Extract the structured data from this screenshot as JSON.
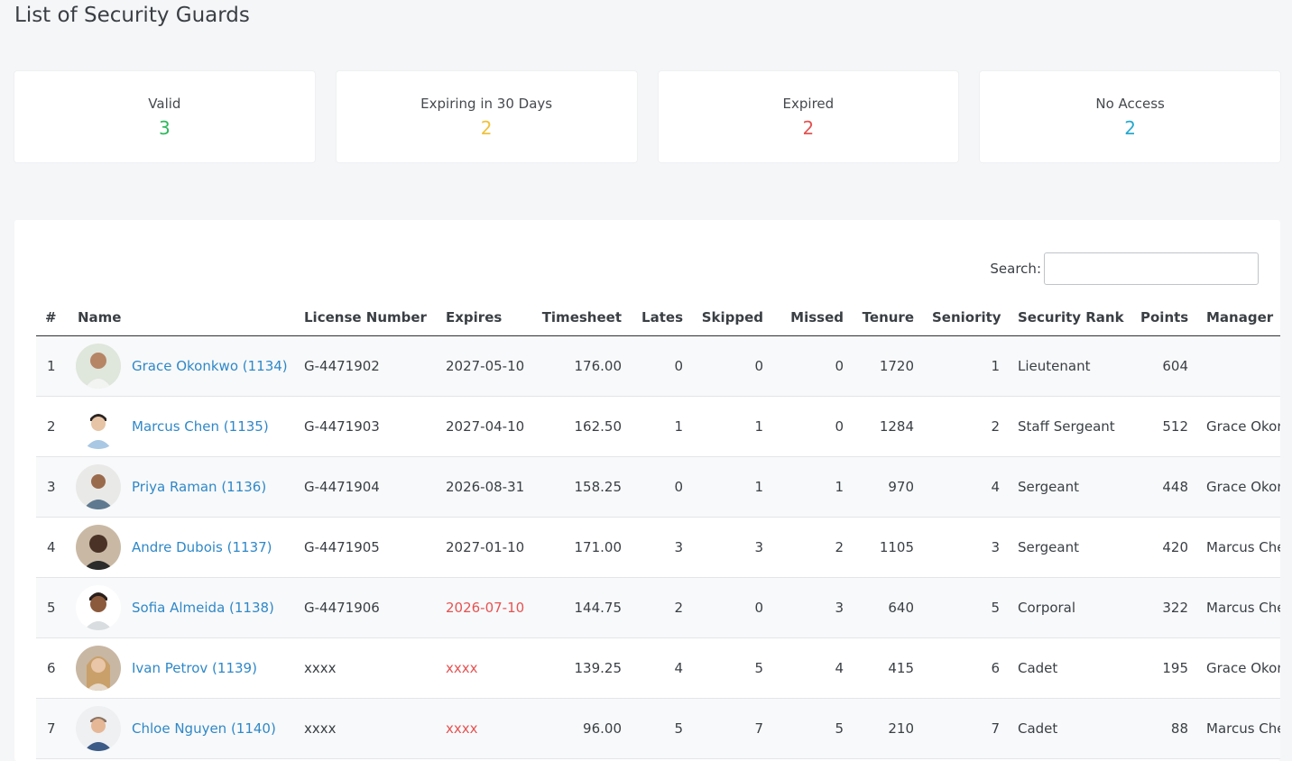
{
  "page": {
    "title": "List of Security Guards"
  },
  "stats": [
    {
      "label": "Valid",
      "value": "3",
      "color": "#2eb85c"
    },
    {
      "label": "Expiring in 30 Days",
      "value": "2",
      "color": "#f0c23b"
    },
    {
      "label": "Expired",
      "value": "2",
      "color": "#e55353"
    },
    {
      "label": "No Access",
      "value": "2",
      "color": "#27a9cf"
    }
  ],
  "search": {
    "label": "Search:",
    "value": ""
  },
  "table": {
    "headers": {
      "num": "#",
      "name": "Name",
      "license": "License Number",
      "expires": "Expires",
      "timesheet": "Timesheet",
      "lates": "Lates",
      "skipped": "Skipped",
      "missed": "Missed",
      "tenure": "Tenure",
      "seniority": "Seniority",
      "rank": "Security Rank",
      "points": "Points",
      "manager": "Manager"
    },
    "rows": [
      {
        "num": "1",
        "name": "Grace Okonkwo (1134)",
        "license": "G-4471902",
        "expires": "2027-05-10",
        "timesheet": "176.00",
        "lates": "0",
        "skipped": "0",
        "missed": "0",
        "tenure": "1720",
        "seniority": "1",
        "rank": "Lieutenant",
        "points": "604",
        "manager": ""
      },
      {
        "num": "2",
        "name": "Marcus Chen (1135)",
        "license": "G-4471903",
        "expires": "2027-04-10",
        "timesheet": "162.50",
        "lates": "1",
        "skipped": "1",
        "missed": "0",
        "tenure": "1284",
        "seniority": "2",
        "rank": "Staff Sergeant",
        "points": "512",
        "manager": "Grace Okonkwo"
      },
      {
        "num": "3",
        "name": "Priya Raman (1136)",
        "license": "G-4471904",
        "expires": "2026-08-31",
        "timesheet": "158.25",
        "lates": "0",
        "skipped": "1",
        "missed": "1",
        "tenure": "970",
        "seniority": "4",
        "rank": "Sergeant",
        "points": "448",
        "manager": "Grace Okonkwo"
      },
      {
        "num": "4",
        "name": "Andre Dubois (1137)",
        "license": "G-4471905",
        "expires": "2027-01-10",
        "timesheet": "171.00",
        "lates": "3",
        "skipped": "3",
        "missed": "2",
        "tenure": "1105",
        "seniority": "3",
        "rank": "Sergeant",
        "points": "420",
        "manager": "Marcus Chen"
      },
      {
        "num": "5",
        "name": "Sofia Almeida (1138)",
        "license": "G-4471906",
        "expires": "2026-07-10",
        "timesheet": "144.75",
        "lates": "2",
        "skipped": "0",
        "missed": "3",
        "tenure": "640",
        "seniority": "5",
        "rank": "Corporal",
        "points": "322",
        "manager": "Marcus Chen"
      },
      {
        "num": "6",
        "name": "Ivan Petrov (1139)",
        "license": "xxxx",
        "expires": "xxxx",
        "timesheet": "139.25",
        "lates": "4",
        "skipped": "5",
        "missed": "4",
        "tenure": "415",
        "seniority": "6",
        "rank": "Cadet",
        "points": "195",
        "manager": "Grace Okonkwo"
      },
      {
        "num": "7",
        "name": "Chloe Nguyen (1140)",
        "license": "xxxx",
        "expires": "xxxx",
        "timesheet": "96.00",
        "lates": "5",
        "skipped": "7",
        "missed": "5",
        "tenure": "210",
        "seniority": "7",
        "rank": "Cadet",
        "points": "88",
        "manager": "Marcus Chen"
      }
    ]
  }
}
